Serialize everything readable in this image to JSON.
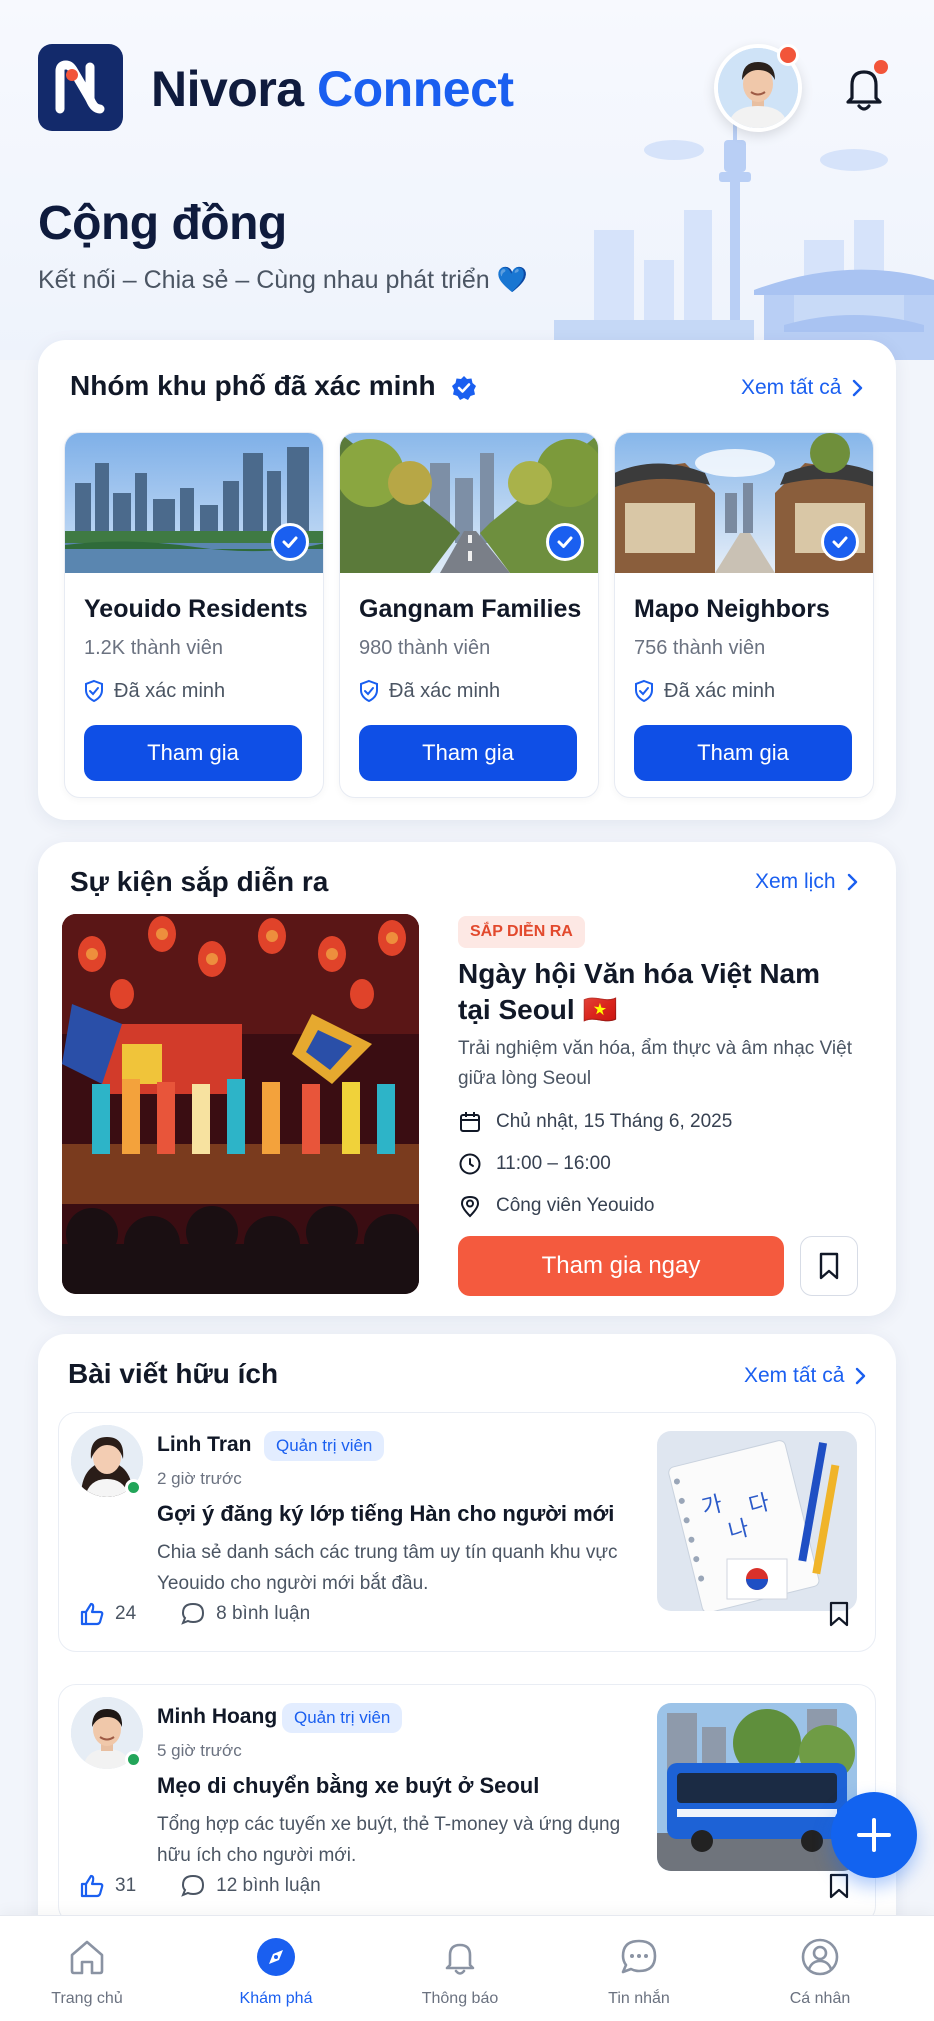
{
  "app": {
    "brand_part1": "Nivora",
    "brand_part2": "Connect"
  },
  "page": {
    "title": "Cộng đồng",
    "subtitle": "Kết nối – Chia sẻ – Cùng nhau phát triển 💙"
  },
  "groups_section": {
    "title": "Nhóm khu phố đã xác minh",
    "see_all": "Xem tất cả",
    "items": [
      {
        "name": "Yeouido Residents",
        "members": "1.2K thành viên",
        "verified_label": "Đã xác minh",
        "join_label": "Tham gia"
      },
      {
        "name": "Gangnam Families",
        "members": "980 thành viên",
        "verified_label": "Đã xác minh",
        "join_label": "Tham gia"
      },
      {
        "name": "Mapo Neighbors",
        "members": "756 thành viên",
        "verified_label": "Đã xác minh",
        "join_label": "Tham gia"
      }
    ]
  },
  "events_section": {
    "title": "Sự kiện sắp diễn ra",
    "see_calendar": "Xem lịch",
    "event": {
      "badge": "SẮP DIỄN RA",
      "title": "Ngày hội Văn hóa Việt Nam tại Seoul 🇻🇳",
      "description": "Trải nghiệm văn hóa, ẩm thực và âm nhạc Việt giữa lòng Seoul",
      "date": "Chủ nhật, 15 Tháng 6, 2025",
      "time": "11:00 – 16:00",
      "location": "Công viên Yeouido",
      "join_label": "Tham gia ngay"
    }
  },
  "posts_section": {
    "title": "Bài viết hữu ích",
    "see_all": "Xem tất cả",
    "posts": [
      {
        "author": "Linh Tran",
        "role": "Quản trị viên",
        "time": "2 giờ trước",
        "title": "Gợi ý đăng ký lớp tiếng Hàn cho người mới",
        "description": "Chia sẻ danh sách các trung tâm uy tín quanh khu vực Yeouido cho người mới bắt đầu.",
        "likes": "24",
        "comments": "8 bình luận",
        "thumb_text": [
          "가",
          "나",
          "다"
        ]
      },
      {
        "author": "Minh Hoang",
        "role": "Quản trị viên",
        "time": "5 giờ trước",
        "title": "Mẹo di chuyển bằng xe buýt ở Seoul",
        "description": "Tổng hợp các tuyến xe buýt, thẻ T-money và ứng dụng hữu ích cho người mới.",
        "likes": "31",
        "comments": "12 bình luận"
      }
    ]
  },
  "bottom_nav": [
    {
      "label": "Trang chủ",
      "icon": "home-icon"
    },
    {
      "label": "Khám phá",
      "icon": "compass-icon",
      "active": true
    },
    {
      "label": "Thông báo",
      "icon": "bell-icon"
    },
    {
      "label": "Tin nhắn",
      "icon": "chat-icon"
    },
    {
      "label": "Cá nhân",
      "icon": "user-icon"
    }
  ],
  "colors": {
    "primary": "#1a5ff0",
    "accent": "#f45a3e",
    "dark": "#0f1b3d"
  }
}
